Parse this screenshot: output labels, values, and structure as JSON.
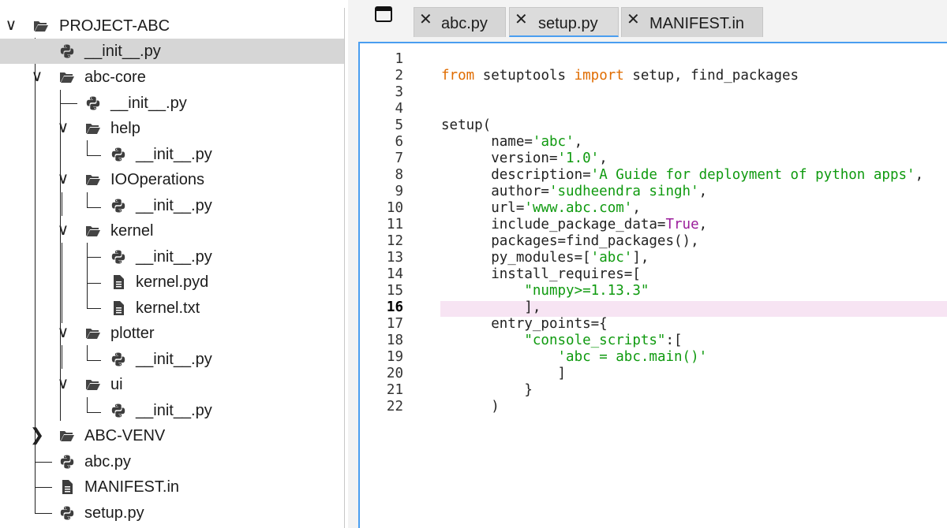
{
  "sidebar": {
    "root": "PROJECT-ABC",
    "root_init": "__init__.py",
    "abc_core": "abc-core",
    "abc_core_init": "__init__.py",
    "help": "help",
    "help_init": "__init__.py",
    "iooperations": "IOOperations",
    "iooperations_init": "__init__.py",
    "kernel": "kernel",
    "kernel_init": "__init__.py",
    "kernel_pyd": "kernel.pyd",
    "kernel_txt": "kernel.txt",
    "plotter": "plotter",
    "plotter_init": "__init__.py",
    "ui": "ui",
    "ui_init": "__init__.py",
    "abc_venv": "ABC-VENV",
    "abc_py": "abc.py",
    "manifest": "MANIFEST.in",
    "setup_py": "setup.py"
  },
  "tabs": [
    {
      "label": "abc.py"
    },
    {
      "label": "setup.py"
    },
    {
      "label": "MANIFEST.in"
    }
  ],
  "editor": {
    "line_numbers": [
      "1",
      "2",
      "3",
      "4",
      "5",
      "6",
      "7",
      "8",
      "9",
      "10",
      "11",
      "12",
      "13",
      "14",
      "15",
      "16",
      "17",
      "18",
      "19",
      "20",
      "21",
      "22"
    ],
    "current_line": "16",
    "code": {
      "l2_from": "from",
      "l2_mod": " setuptools ",
      "l2_import": "import",
      "l2_rest": " setup, find_packages",
      "l5": "setup(",
      "l6_key": "      name=",
      "l6_val": "'abc'",
      "l6_end": ",",
      "l7_key": "      version=",
      "l7_val": "'1.0'",
      "l7_end": ",",
      "l8_key": "      description=",
      "l8_val": "'A Guide for deployment of python apps'",
      "l8_end": ",",
      "l9_key": "      author=",
      "l9_val": "'sudheendra singh'",
      "l9_end": ",",
      "l10_key": "      url=",
      "l10_val": "'www.abc.com'",
      "l10_end": ",",
      "l11_key": "      include_package_data=",
      "l11_val": "True",
      "l11_end": ",",
      "l12": "      packages=find_packages(),",
      "l13_key": "      py_modules=[",
      "l13_val": "'abc'",
      "l13_end": "],",
      "l14": "      install_requires=[",
      "l15_pad": "          ",
      "l15_val": "\"numpy>=1.13.3\"",
      "l16": "          ],",
      "l17": "      entry_points={",
      "l18_pad": "          ",
      "l18_val": "\"console_scripts\"",
      "l18_end": ":[",
      "l19_pad": "              ",
      "l19_val": "'abc = abc.main()'",
      "l20": "              ]",
      "l21": "          }",
      "l22": "      )"
    }
  },
  "icons": {
    "folder": "folder-open-icon",
    "python": "python-file-icon",
    "document": "document-file-icon",
    "layout": "split-layout-icon",
    "close": "close-icon"
  },
  "colors": {
    "accent": "#4a9ef0",
    "keyword": "#e06c00",
    "string": "#0f9a0f",
    "boolean": "#9b1c9b",
    "selection": "#d6d6d6",
    "current_line": "#f7e4f3"
  }
}
